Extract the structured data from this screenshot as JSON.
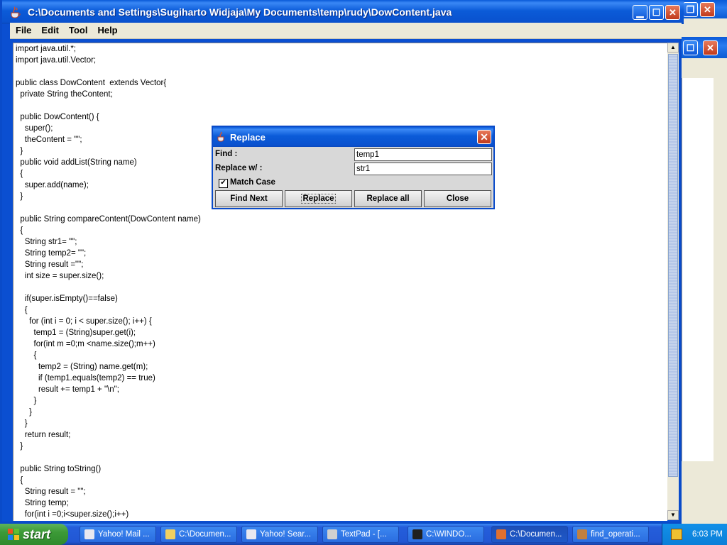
{
  "window": {
    "title": "C:\\Documents and Settings\\Sugiharto Widjaja\\My Documents\\temp\\rudy\\DowContent.java",
    "minimize_glyph": "▁",
    "maximize_glyph": "☐",
    "close_glyph": "✕"
  },
  "menu": {
    "file": "File",
    "edit": "Edit",
    "tool": "Tool",
    "help": "Help"
  },
  "editor": {
    "code": "import java.util.*;\nimport java.util.Vector;\n\npublic class DowContent  extends Vector{\n  private String theContent;\n\n  public DowContent() {\n    super();\n    theContent = \"\";\n  }\n  public void addList(String name)\n  {\n    super.add(name);\n  }\n\n  public String compareContent(DowContent name)\n  {\n    String str1= \"\";\n    String temp2= \"\";\n    String result =\"\";\n    int size = super.size();\n\n    if(super.isEmpty()==false)\n    {\n      for (int i = 0; i < super.size(); i++) {\n        temp1 = (String)super.get(i);\n        for(int m =0;m <name.size();m++)\n        {\n          temp2 = (String) name.get(m);\n          if (temp1.equals(temp2) == true)\n          result += temp1 + \"\\n\";\n        }\n      }\n    }\n    return result;\n  }\n\n  public String toString()\n  {\n    String result = \"\";\n    String temp;\n    for(int i =0;i<super.size();i++)"
  },
  "dialog": {
    "title": "Replace",
    "find_label": "Find :",
    "find_value": "temp1",
    "replace_label": "Replace w/ :",
    "replace_value": "str1",
    "match_case_label": "Match Case",
    "match_case_checked": true,
    "check_glyph": "✔",
    "close_glyph": "✕",
    "buttons": {
      "find_next": "Find Next",
      "replace": "Replace",
      "replace_all": "Replace all",
      "close": "Close"
    }
  },
  "taskbar": {
    "start_label": "start",
    "tasks": [
      {
        "label": "Yahoo! Mail ...",
        "color": "#e8e8f0"
      },
      {
        "label": "C:\\Documen...",
        "color": "#f0d060"
      },
      {
        "label": "Yahoo! Sear...",
        "color": "#e8e8f0"
      },
      {
        "label": "TextPad - [...",
        "color": "#d0d0d0"
      },
      {
        "label": "C:\\WINDO...",
        "color": "#202020"
      },
      {
        "label": "C:\\Documen...",
        "color": "#e07030"
      },
      {
        "label": "find_operati...",
        "color": "#c08040"
      }
    ],
    "clock": "6:03 PM"
  },
  "colors": {
    "title_blue": "#0b5bd8",
    "taskbar_blue": "#245edb",
    "start_green": "#3c9a37",
    "dialog_bg": "#d8d8d8",
    "editor_bg": "#ffffff"
  }
}
